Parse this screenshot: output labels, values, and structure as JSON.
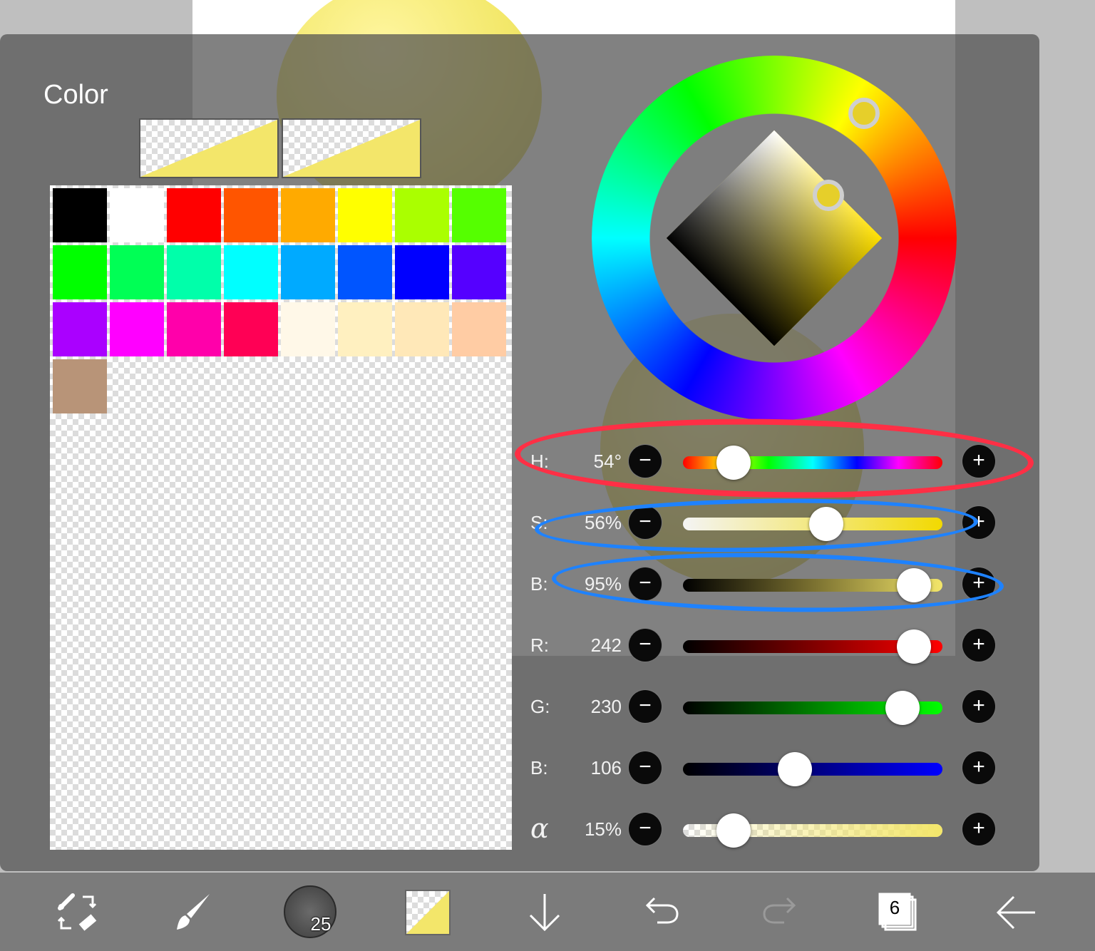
{
  "panel": {
    "title": "Color"
  },
  "current_color": "#f3e66a",
  "palette": [
    "#000000",
    "#ffffff",
    "#ff0000",
    "#ff5500",
    "#ffaa00",
    "#ffff00",
    "#aaff00",
    "#55ff00",
    "#00ff00",
    "#00ff55",
    "#00ffaa",
    "#00ffff",
    "#00aaff",
    "#0055ff",
    "#0000ff",
    "#5500ff",
    "#aa00ff",
    "#ff00ff",
    "#ff00aa",
    "#ff0055",
    "#fff8e8",
    "#fff0c0",
    "#ffe8b8",
    "#ffcca4",
    "#b89478"
  ],
  "sliders": {
    "h": {
      "label": "H:",
      "value": "54°",
      "level": 0.15
    },
    "s": {
      "label": "S:",
      "value": "56%",
      "level": 0.56
    },
    "v": {
      "label": "B:",
      "value": "95%",
      "level": 0.95
    },
    "r": {
      "label": "R:",
      "value": "242",
      "level": 0.95
    },
    "g": {
      "label": "G:",
      "value": "230",
      "level": 0.9
    },
    "b": {
      "label": "B:",
      "value": "106",
      "level": 0.42
    },
    "alpha": {
      "label": "α",
      "value": "15%",
      "level": 0.15
    }
  },
  "buttons": {
    "minus": "−",
    "plus": "+"
  },
  "toolbar": {
    "brush_size": "25",
    "layer_count": "6"
  },
  "annotations": {
    "red": "#ff2f45",
    "blue": "#1e82ff"
  }
}
